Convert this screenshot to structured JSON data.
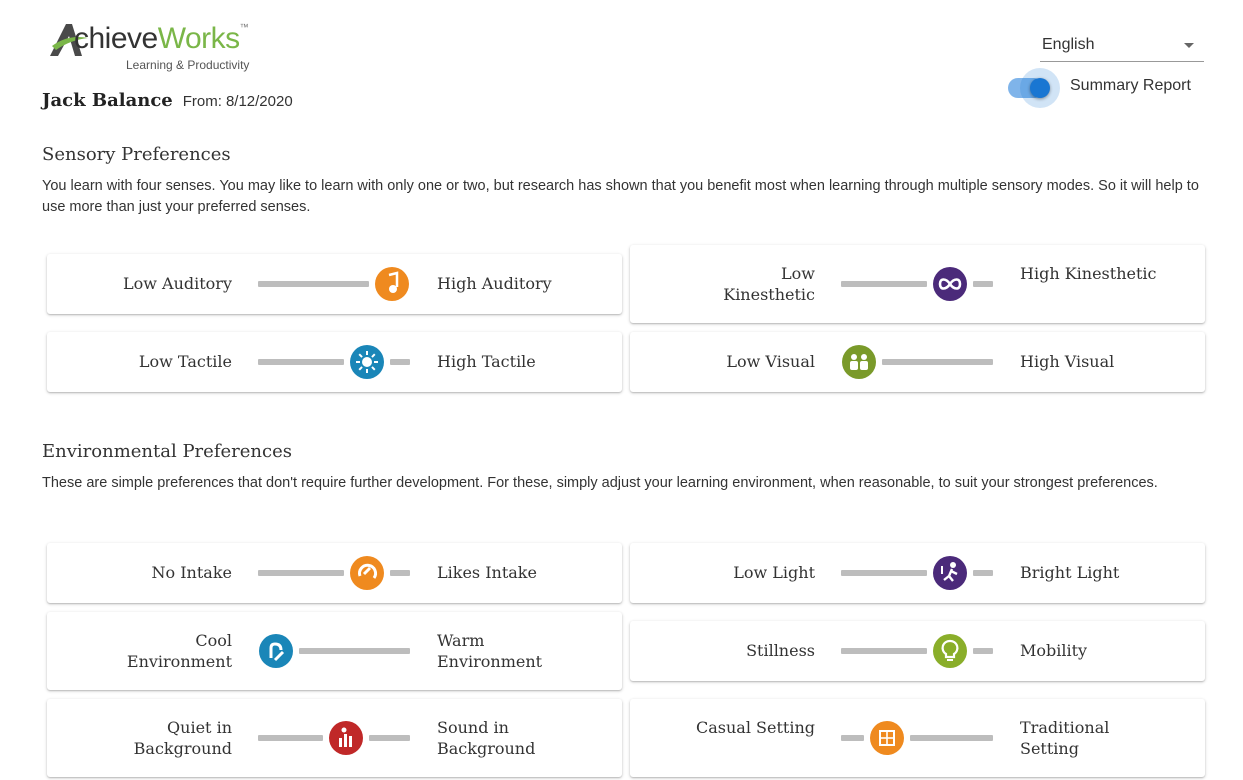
{
  "header": {
    "logo": {
      "brand_part1": "chieve",
      "brand_part2": "Works",
      "tagline": "Learning & Productivity",
      "trademark": "™"
    },
    "person_name": "Jack Balance",
    "from_label": "From:",
    "from_date": "8/12/2020",
    "language": {
      "selected": "English"
    },
    "summary_toggle": {
      "label": "Summary Report",
      "on": true
    }
  },
  "colors": {
    "accent": "#1976d2",
    "brand_green": "#7ab648",
    "bar": "#bdbdbd"
  },
  "sensory": {
    "title": "Sensory Preferences",
    "description": "You learn with four senses. You may like to learn with only one or two, but research has shown that you benefit most when learning through multiple sensory modes. So it will help to use more than just your preferred senses.",
    "items": [
      {
        "low": "Low Auditory",
        "high": "High Auditory",
        "level": 0.88,
        "icon": "music-note-icon",
        "color": "#ef8a1f"
      },
      {
        "low": "Low Kinesthetic",
        "high": "High Kinesthetic",
        "level": 0.72,
        "icon": "infinity-icon",
        "color": "#4b2a7a"
      },
      {
        "low": "Low Tactile",
        "high": "High Tactile",
        "level": 0.72,
        "icon": "touch-sparkle-icon",
        "color": "#1a86b8"
      },
      {
        "low": "Low Visual",
        "high": "High Visual",
        "level": 0.12,
        "icon": "people-group-icon",
        "color": "#7a9a2a"
      }
    ]
  },
  "environmental": {
    "title": "Environmental Preferences",
    "description": "These are simple preferences that don't require further development. For these, simply adjust your learning environment, when reasonable, to suit your strongest preferences.",
    "items": [
      {
        "low": "No Intake",
        "high": "Likes Intake",
        "level": 0.72,
        "icon": "intake-swirl-icon",
        "color": "#ef8a1f"
      },
      {
        "low": "Low Light",
        "high": "Bright Light",
        "level": 0.72,
        "icon": "person-light-icon",
        "color": "#4b2a7a"
      },
      {
        "low": "Cool Environment",
        "high": "Warm Environment",
        "level": 0.12,
        "icon": "hand-temperature-icon",
        "color": "#1a86b8"
      },
      {
        "low": "Stillness",
        "high": "Mobility",
        "level": 0.72,
        "icon": "lightbulb-icon",
        "color": "#8aae2a"
      },
      {
        "low": "Quiet in Background",
        "high": "Sound in Background",
        "level": 0.58,
        "icon": "sound-bars-icon",
        "color": "#c02828"
      },
      {
        "low": "Casual Setting",
        "high": "Traditional Setting",
        "level": 0.3,
        "icon": "table-grid-icon",
        "color": "#ef8a1f"
      }
    ]
  }
}
